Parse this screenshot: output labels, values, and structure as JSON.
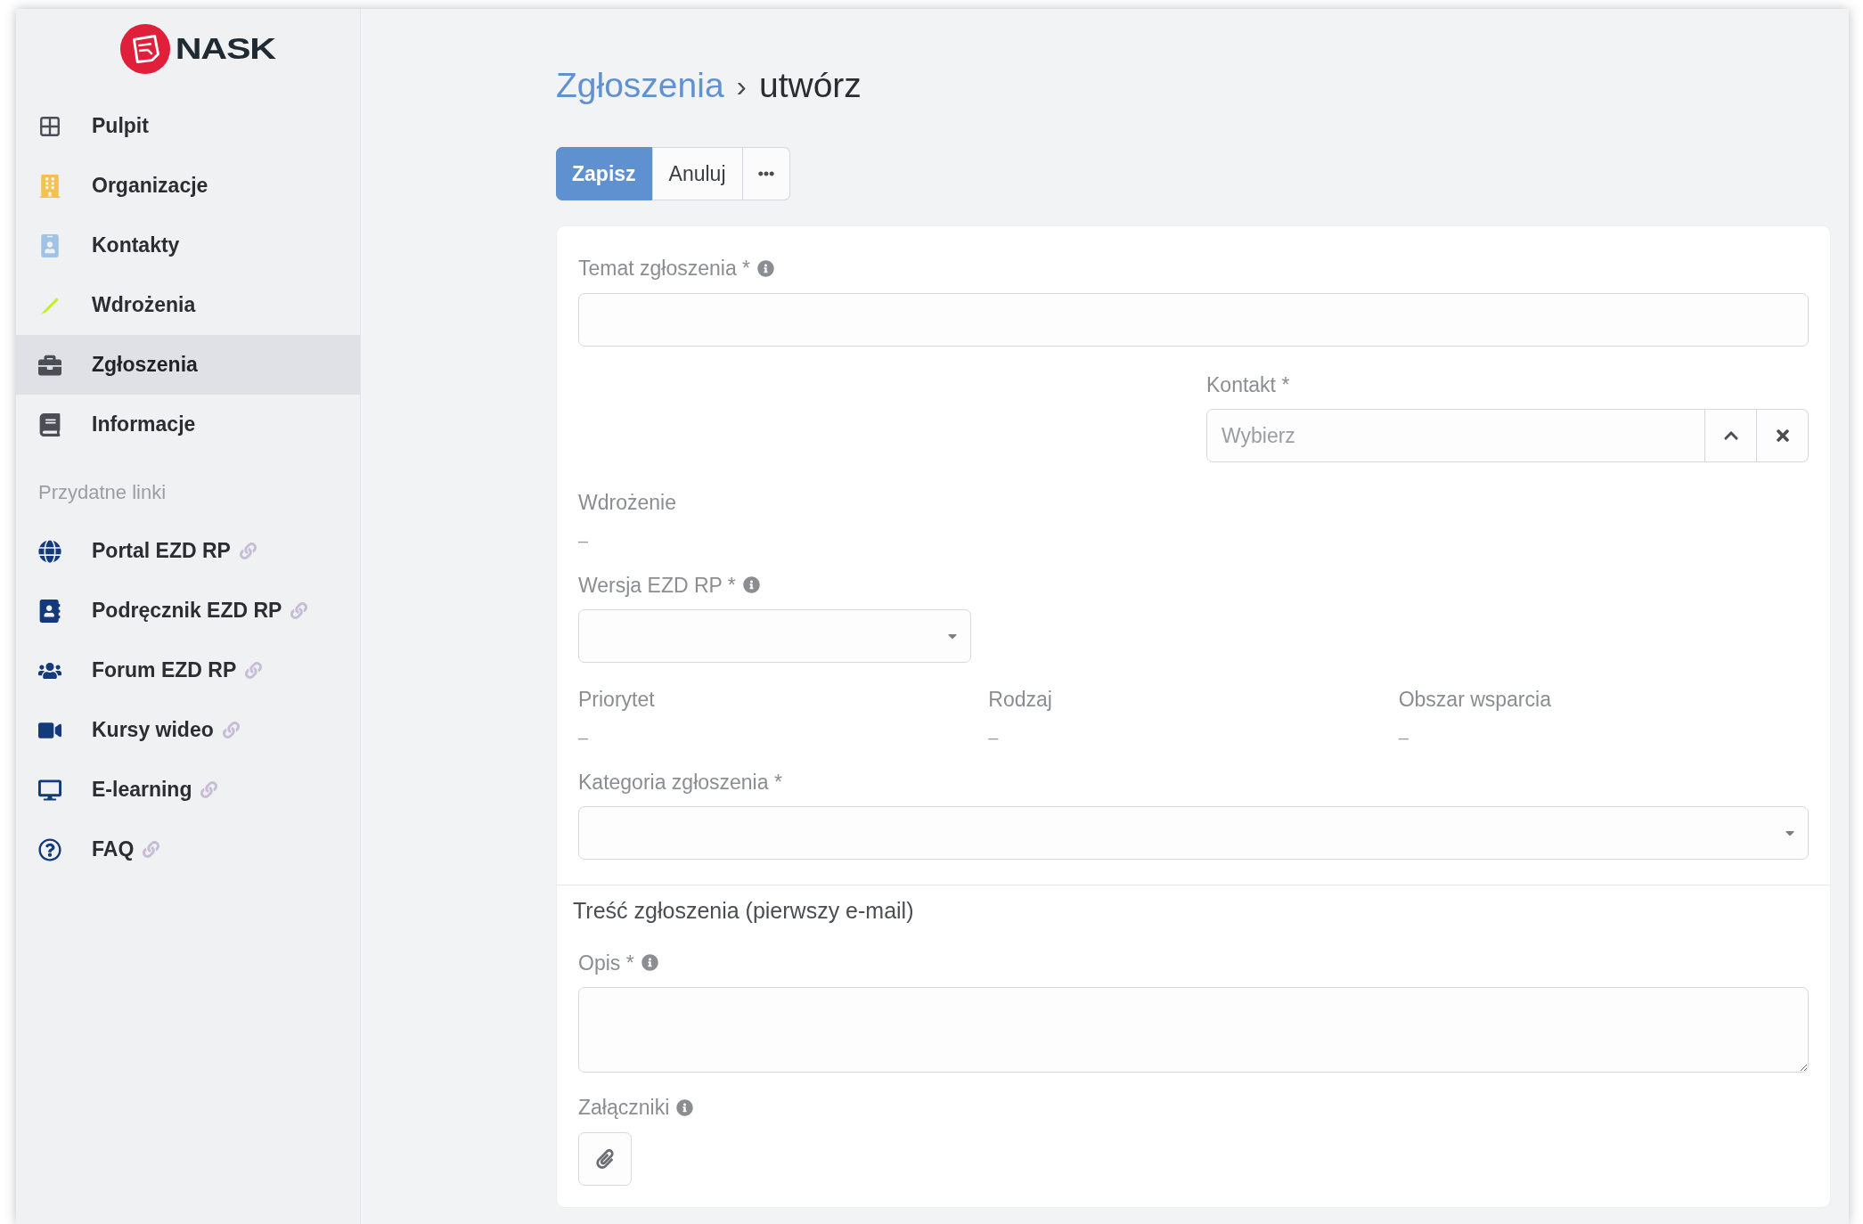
{
  "sidebar": {
    "logo": "NASK",
    "nav": [
      {
        "label": "Pulpit",
        "selected": false
      },
      {
        "label": "Organizacje",
        "selected": false
      },
      {
        "label": "Kontakty",
        "selected": false
      },
      {
        "label": "Wdrożenia",
        "selected": false
      },
      {
        "label": "Zgłoszenia",
        "selected": true
      },
      {
        "label": "Informacje",
        "selected": false
      }
    ],
    "section_title": "Przydatne linki",
    "links": [
      {
        "label": "Portal EZD RP"
      },
      {
        "label": "Podręcznik EZD RP"
      },
      {
        "label": "Forum EZD RP"
      },
      {
        "label": "Kursy wideo"
      },
      {
        "label": "E-learning"
      },
      {
        "label": "FAQ"
      }
    ]
  },
  "breadcrumb": {
    "parent": "Zgłoszenia",
    "separator": "›",
    "current": "utwórz"
  },
  "toolbar": [
    {
      "kind": "primary",
      "label": "Zapisz"
    },
    {
      "kind": "plain",
      "label": "Anuluj"
    },
    {
      "kind": "more"
    }
  ],
  "form": {
    "subject": {
      "label": "Temat zgłoszenia *",
      "info": true
    },
    "contact": {
      "label": "Kontakt *",
      "placeholder": "Wybierz",
      "expanded": true
    },
    "deployment": {
      "label": "Wdrożenie",
      "value": "–"
    },
    "version": {
      "label": "Wersja EZD RP *",
      "info": true
    },
    "details": [
      {
        "label": "Priorytet",
        "value": "–"
      },
      {
        "label": "Rodzaj",
        "value": "–"
      },
      {
        "label": "Obszar wsparcia",
        "value": "–"
      }
    ],
    "category": {
      "label": "Kategoria zgłoszenia *",
      "info": false
    },
    "section_title": "Treść zgłoszenia (pierwszy e-mail)",
    "description": {
      "label": "Opis *",
      "info": true
    },
    "attachments": {
      "label": "Załączniki",
      "info": true
    }
  }
}
